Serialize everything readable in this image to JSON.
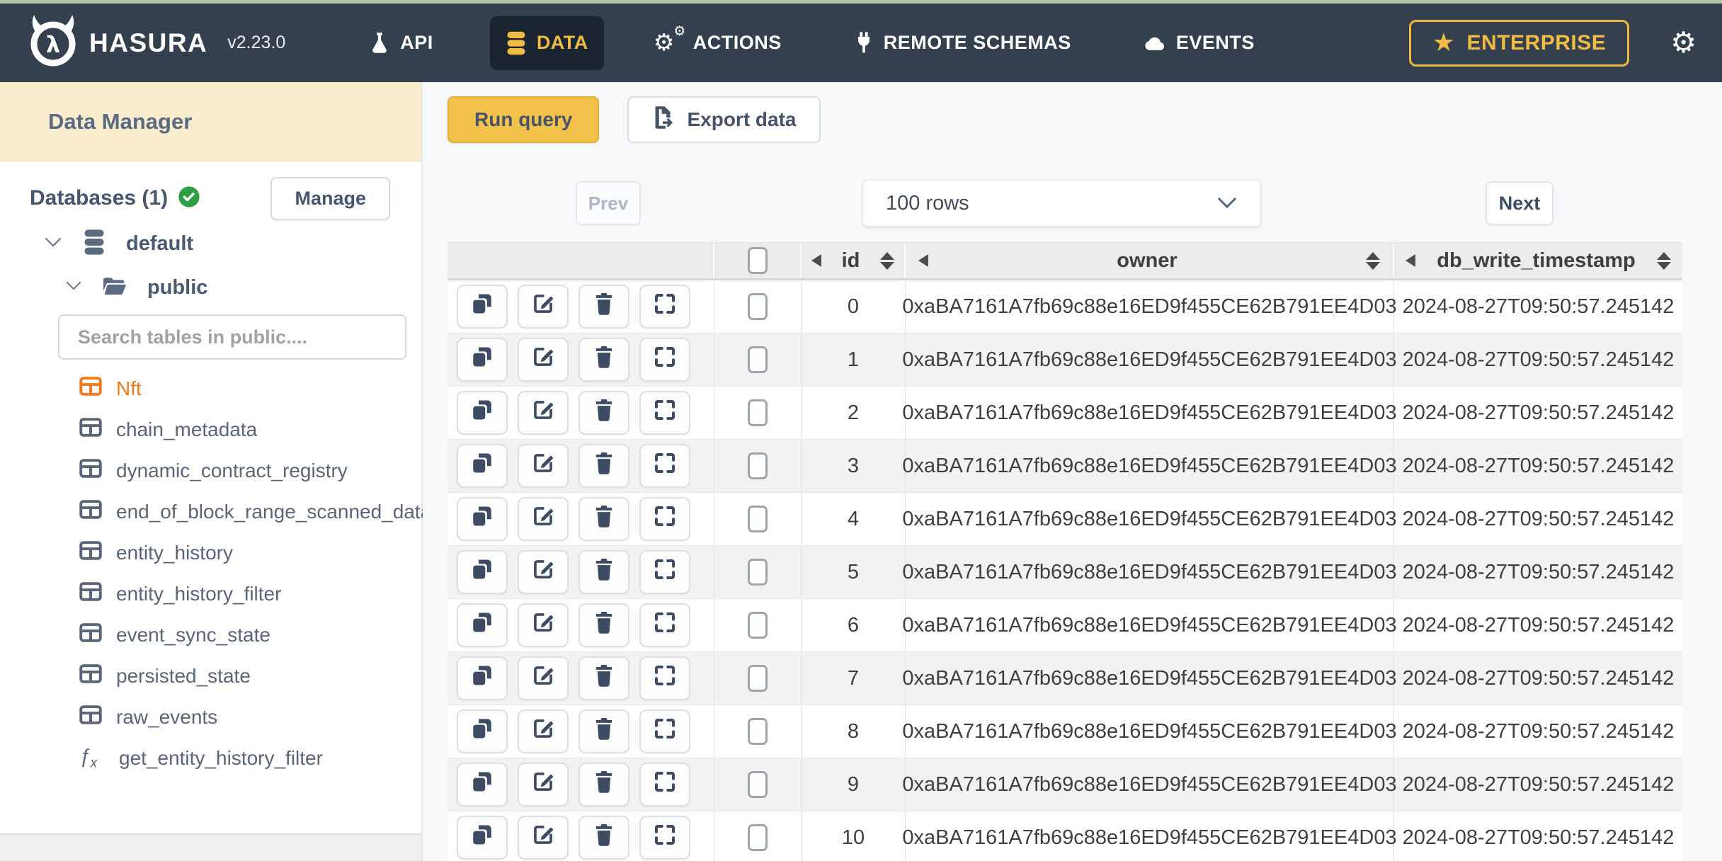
{
  "topbar": {
    "brand": "HASURA",
    "version": "v2.23.0",
    "nav": [
      {
        "label": "API",
        "icon": "flask-icon",
        "active": false
      },
      {
        "label": "DATA",
        "icon": "database-icon",
        "active": true
      },
      {
        "label": "ACTIONS",
        "icon": "gears-icon",
        "active": false
      },
      {
        "label": "REMOTE SCHEMAS",
        "icon": "plug-icon",
        "active": false
      },
      {
        "label": "EVENTS",
        "icon": "cloud-icon",
        "active": false
      }
    ],
    "enterprise_label": "ENTERPRISE",
    "enterprise_icon": "star-icon",
    "settings_icon": "gear-icon",
    "colors": {
      "navbar_bg": "#35404f",
      "active_item_bg": "#1b2531",
      "accent_gold": "#f1bc45",
      "top_strip": "#adc7a4"
    }
  },
  "sidebar": {
    "title": "Data Manager",
    "databases_label": "Databases (1)",
    "databases_status_icon": "check-circle-icon",
    "status_color": "#2e9e44",
    "manage_label": "Manage",
    "tree": {
      "database": "default",
      "schema": "public"
    },
    "search_placeholder": "Search tables in public....",
    "selected_color": "#f07b1f",
    "tables": [
      {
        "name": "Nft",
        "icon": "table-icon",
        "selected": true
      },
      {
        "name": "chain_metadata",
        "icon": "table-icon",
        "selected": false
      },
      {
        "name": "dynamic_contract_registry",
        "icon": "table-icon",
        "selected": false
      },
      {
        "name": "end_of_block_range_scanned_data",
        "icon": "table-icon",
        "selected": false
      },
      {
        "name": "entity_history",
        "icon": "table-icon",
        "selected": false
      },
      {
        "name": "entity_history_filter",
        "icon": "table-icon",
        "selected": false
      },
      {
        "name": "event_sync_state",
        "icon": "table-icon",
        "selected": false
      },
      {
        "name": "persisted_state",
        "icon": "table-icon",
        "selected": false
      },
      {
        "name": "raw_events",
        "icon": "table-icon",
        "selected": false
      },
      {
        "name": "get_entity_history_filter",
        "icon": "function-icon",
        "selected": false
      }
    ]
  },
  "toolbar": {
    "run_query_label": "Run query",
    "export_data_label": "Export data",
    "export_icon": "export-file-icon",
    "run_query_color": "#f2c24b"
  },
  "pagination": {
    "prev_label": "Prev",
    "rows_select_value": "100 rows",
    "next_label": "Next"
  },
  "table": {
    "columns": [
      "id",
      "owner",
      "db_write_timestamp"
    ],
    "row_actions": [
      "copy-row",
      "edit-row",
      "delete-row",
      "expand-row"
    ],
    "rows": [
      {
        "id": "0",
        "owner": "0xaBA7161A7fb69c88e16ED9f455CE62B791EE4D03",
        "db_write_timestamp": "2024-08-27T09:50:57.245142"
      },
      {
        "id": "1",
        "owner": "0xaBA7161A7fb69c88e16ED9f455CE62B791EE4D03",
        "db_write_timestamp": "2024-08-27T09:50:57.245142"
      },
      {
        "id": "2",
        "owner": "0xaBA7161A7fb69c88e16ED9f455CE62B791EE4D03",
        "db_write_timestamp": "2024-08-27T09:50:57.245142"
      },
      {
        "id": "3",
        "owner": "0xaBA7161A7fb69c88e16ED9f455CE62B791EE4D03",
        "db_write_timestamp": "2024-08-27T09:50:57.245142"
      },
      {
        "id": "4",
        "owner": "0xaBA7161A7fb69c88e16ED9f455CE62B791EE4D03",
        "db_write_timestamp": "2024-08-27T09:50:57.245142"
      },
      {
        "id": "5",
        "owner": "0xaBA7161A7fb69c88e16ED9f455CE62B791EE4D03",
        "db_write_timestamp": "2024-08-27T09:50:57.245142"
      },
      {
        "id": "6",
        "owner": "0xaBA7161A7fb69c88e16ED9f455CE62B791EE4D03",
        "db_write_timestamp": "2024-08-27T09:50:57.245142"
      },
      {
        "id": "7",
        "owner": "0xaBA7161A7fb69c88e16ED9f455CE62B791EE4D03",
        "db_write_timestamp": "2024-08-27T09:50:57.245142"
      },
      {
        "id": "8",
        "owner": "0xaBA7161A7fb69c88e16ED9f455CE62B791EE4D03",
        "db_write_timestamp": "2024-08-27T09:50:57.245142"
      },
      {
        "id": "9",
        "owner": "0xaBA7161A7fb69c88e16ED9f455CE62B791EE4D03",
        "db_write_timestamp": "2024-08-27T09:50:57.245142"
      },
      {
        "id": "10",
        "owner": "0xaBA7161A7fb69c88e16ED9f455CE62B791EE4D03",
        "db_write_timestamp": "2024-08-27T09:50:57.245142"
      }
    ]
  }
}
